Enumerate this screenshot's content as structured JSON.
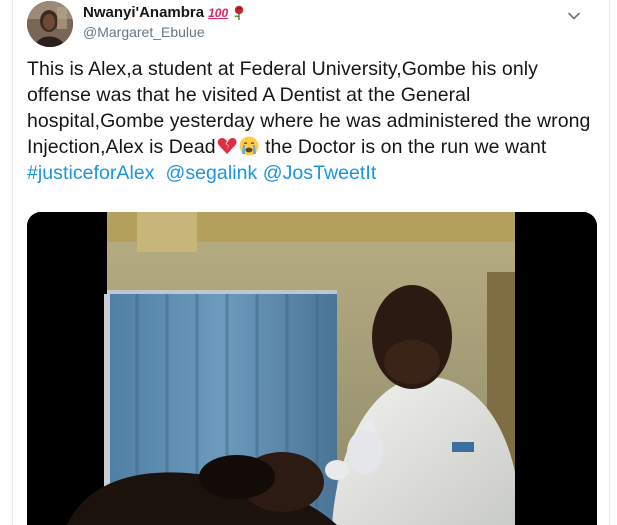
{
  "author": {
    "display_name": "Nwanyi'Anambra",
    "handle": "@Margaret_Ebulue",
    "emoji_100": "100",
    "rose_icon": "rose-icon"
  },
  "tweet": {
    "text_before_hashtag": "This is Alex,a student at Federal University,Gombe his only offense was that he visited A Dentist at the General hospital,Gombe yesterday where he was administered the wrong Injection,Alex is Dead",
    "text_after_emoji": "the Doctor is on the run we want",
    "hashtag": "#justiceforAlex",
    "mention_1": "@segalink",
    "mention_2": "@JosTweetIt",
    "emoji_1": "broken-heart-icon",
    "emoji_2": "crying-face-icon"
  },
  "media": {
    "type": "video-still",
    "description_icon": "video-thumbnail"
  },
  "colors": {
    "link": "#1b95e0",
    "text": "#14171a",
    "secondary": "#657786",
    "border": "#e6ecf0"
  }
}
